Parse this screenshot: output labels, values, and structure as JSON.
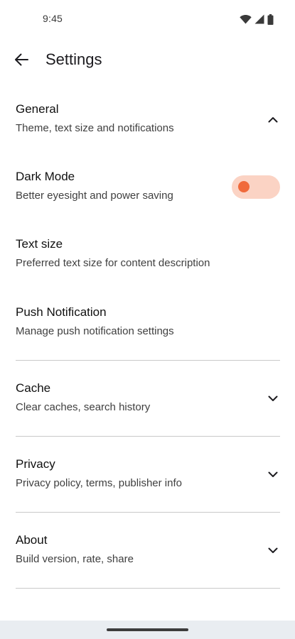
{
  "status_bar": {
    "time": "9:45",
    "icons": [
      "wifi-icon",
      "signal-icon",
      "battery-icon"
    ]
  },
  "top_bar": {
    "back_icon": "arrow-back-icon",
    "title": "Settings"
  },
  "settings": {
    "general": {
      "title": "General",
      "subtitle": "Theme, text size and notifications",
      "icon": "chevron-up-icon",
      "expanded": true
    },
    "dark_mode": {
      "title": "Dark Mode",
      "subtitle": "Better eyesight and power saving",
      "toggle_on": false
    },
    "text_size": {
      "title": "Text size",
      "subtitle": "Preferred text size for content description"
    },
    "push_notification": {
      "title": "Push Notification",
      "subtitle": "Manage push notification settings"
    },
    "cache": {
      "title": "Cache",
      "subtitle": "Clear caches, search history",
      "icon": "chevron-down-icon"
    },
    "privacy": {
      "title": "Privacy",
      "subtitle": "Privacy policy, terms, publisher info",
      "icon": "chevron-down-icon"
    },
    "about": {
      "title": "About",
      "subtitle": "Build version, rate, share",
      "icon": "chevron-down-icon"
    }
  },
  "colors": {
    "accent": "#f06a3b",
    "toggle_track": "#fbd3c4",
    "divider": "#c9c9c9",
    "nav_bar": "#e9edf1"
  }
}
